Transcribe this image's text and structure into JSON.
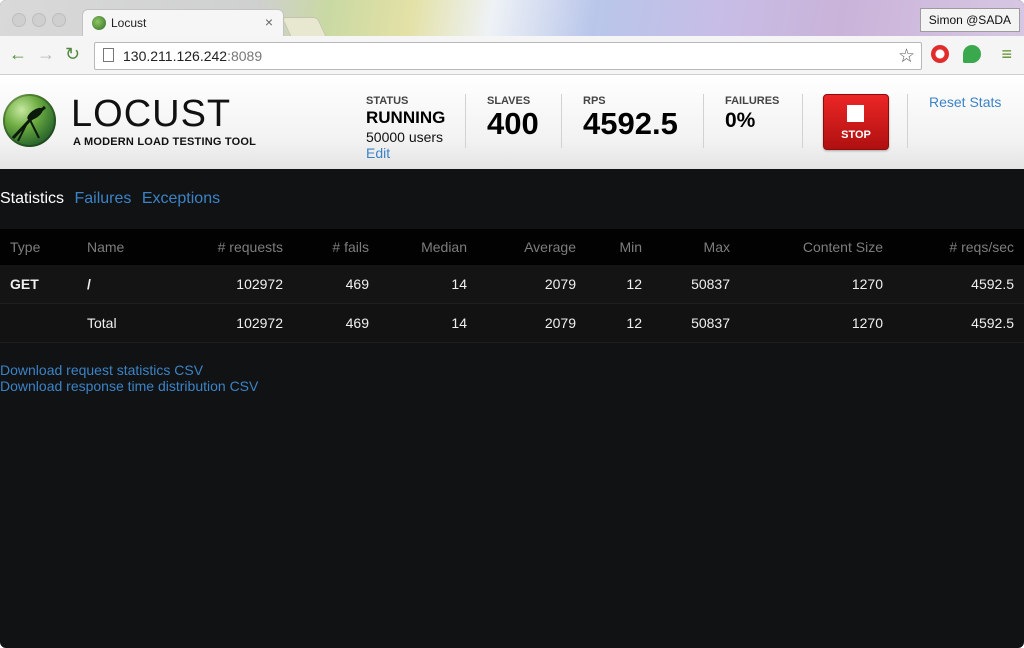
{
  "browser": {
    "tab_title": "Locust",
    "tab_close": "×",
    "profile": "Simon @SADA",
    "url_host": "130.211.126.242",
    "url_port": ":8089"
  },
  "header": {
    "brand": "LOCUST",
    "tagline": "A MODERN LOAD TESTING TOOL",
    "status_label": "STATUS",
    "status_value": "RUNNING",
    "users": "50000 users",
    "edit": "Edit",
    "slaves_label": "SLAVES",
    "slaves_value": "400",
    "rps_label": "RPS",
    "rps_value": "4592.5",
    "failures_label": "FAILURES",
    "failures_value": "0%",
    "stop_label": "STOP",
    "reset_label": "Reset Stats"
  },
  "tabs": [
    "Statistics",
    "Failures",
    "Exceptions"
  ],
  "table": {
    "headers": [
      "Type",
      "Name",
      "# requests",
      "# fails",
      "Median",
      "Average",
      "Min",
      "Max",
      "Content Size",
      "# reqs/sec"
    ],
    "rows": [
      [
        "GET",
        "/",
        "102972",
        "469",
        "14",
        "2079",
        "12",
        "50837",
        "1270",
        "4592.5"
      ],
      [
        "",
        "Total",
        "102972",
        "469",
        "14",
        "2079",
        "12",
        "50837",
        "1270",
        "4592.5"
      ]
    ]
  },
  "downloads": [
    "Download request statistics CSV",
    "Download response time distribution CSV"
  ],
  "colors": {
    "link": "#3b83c7",
    "stop": "#d81b1b",
    "background": "#111213"
  }
}
